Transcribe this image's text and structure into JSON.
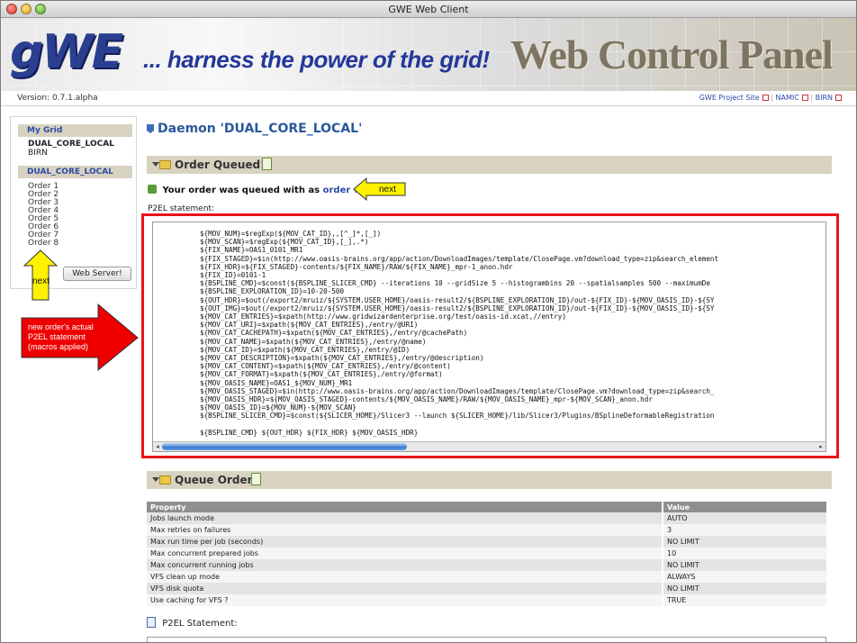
{
  "window": {
    "title": "GWE Web Client"
  },
  "banner": {
    "logo_text": "gWE",
    "tagline": "... harness the power of the grid!",
    "panel_title": "Web Control Panel"
  },
  "version_bar": {
    "version": "Version: 0.7.1.alpha",
    "links": [
      "GWE Project Site",
      "NAMIC",
      "BIRN"
    ],
    "separator": "|"
  },
  "sidebar": {
    "my_grid_header": "My Grid",
    "grid_items": [
      "DUAL_CORE_LOCAL",
      "BIRN"
    ],
    "daemon_header": "DUAL_CORE_LOCAL",
    "orders": [
      "Order 1",
      "Order 2",
      "Order 3",
      "Order 4",
      "Order 5",
      "Order 6",
      "Order 7",
      "Order 8"
    ],
    "web_server_button": "Web Server!"
  },
  "main": {
    "daemon_title": "Daemon 'DUAL_CORE_LOCAL'",
    "order_queued": {
      "section_label": "Order Queued!",
      "message_prefix": "Your order was queued with as",
      "order_link": "order # 8",
      "message_suffix": ".",
      "p2el_label": "P2EL statement:",
      "code_lines": [
        "${MOV_NUM}=$regExp(${MOV_CAT_ID},,[^_]*,[_])",
        "${MOV_SCAN}=$regExp(${MOV_CAT_ID},[_],.*)",
        "${FIX_NAME}=OAS1_0101_MR1",
        "${FIX_STAGED}=$in(http://www.oasis-brains.org/app/action/DownloadImages/template/ClosePage.vm?download_type=zip&search_element",
        "${FIX_HDR}=${FIX_STAGED}-contents/${FIX_NAME}/RAW/${FIX_NAME}_mpr-1_anon.hdr",
        "${FIX_ID}=0101-1",
        "${BSPLINE_CMD}=$const(${BSPLINE_SLICER_CMD} --iterations 10 --gridSize 5 --histogrambins 20 --spatialsamples 500 --maximumDe",
        "${BSPLINE_EXPLORATION_ID}=10-20-500",
        "${OUT_HDR}=$out(/export2/mruiz/${SYSTEM.USER_HOME}/oasis-result2/${BSPLINE_EXPLORATION_ID}/out-${FIX_ID}-${MOV_OASIS_ID}-${SY",
        "${OUT_IMG}=$out(/export2/mruiz/${SYSTEM.USER_HOME}/oasis-result2/${BSPLINE_EXPLORATION_ID}/out-${FIX_ID}-${MOV_OASIS_ID}-${SY",
        "${MOV_CAT_ENTRIES}=$xpath(http://www.gridwizardenterprise.org/test/oasis-id.xcat,//entry)",
        "${MOV_CAT_URI}=$xpath(${MOV_CAT_ENTRIES},/entry/@URI)",
        "${MOV_CAT_CACHEPATH}=$xpath(${MOV_CAT_ENTRIES},/entry/@cachePath)",
        "${MOV_CAT_NAME}=$xpath(${MOV_CAT_ENTRIES},/entry/@name)",
        "${MOV_CAT_ID}=$xpath(${MOV_CAT_ENTRIES},/entry/@ID)",
        "${MOV_CAT_DESCRIPTION}=$xpath(${MOV_CAT_ENTRIES},/entry/@description)",
        "${MOV_CAT_CONTENT}=$xpath(${MOV_CAT_ENTRIES},/entry/@content)",
        "${MOV_CAT_FORMAT}=$xpath(${MOV_CAT_ENTRIES},/entry/@format)",
        "${MOV_OASIS_NAME}=OAS1_${MOV_NUM}_MR1",
        "${MOV_OASIS_STAGED}=$in(http://www.oasis-brains.org/app/action/DownloadImages/template/ClosePage.vm?download_type=zip&search_",
        "${MOV_OASIS_HDR}=${MOV_OASIS_STAGED}-contents/${MOV_OASIS_NAME}/RAW/${MOV_OASIS_NAME}_mpr-${MOV_SCAN}_anon.hdr",
        "${MOV_OASIS_ID}=${MOV_NUM}-${MOV_SCAN}",
        "${BSPLINE_SLICER_CMD}=$const(${SLICER_HOME}/Slicer3 --launch ${SLICER_HOME}/lib/Slicer3/Plugins/BSplineDeformableRegistration",
        "",
        "${BSPLINE_CMD} ${OUT_HDR} ${FIX_HDR} ${MOV_OASIS_HDR}"
      ]
    },
    "queue_order": {
      "section_label": "Queue Order",
      "table_headers": [
        "Property",
        "Value"
      ],
      "rows": [
        [
          "Jobs launch mode",
          "AUTO"
        ],
        [
          "Max retries on failures",
          "3"
        ],
        [
          "Max run time per job (seconds)",
          "NO LIMIT"
        ],
        [
          "Max concurrent prepared jobs",
          "10"
        ],
        [
          "Max concurrent running jobs",
          "NO LIMIT"
        ],
        [
          "VFS clean up mode",
          "ALWAYS"
        ],
        [
          "VFS disk quota",
          "NO LIMIT"
        ],
        [
          "Use caching for VFS ?",
          "TRUE"
        ]
      ],
      "p2el_statement_label": "P2EL Statement:"
    }
  },
  "annotations": {
    "next_top": "next",
    "next_left": "next",
    "red_note": [
      "new order's actual",
      "P2EL statement",
      "(macros applied)"
    ]
  },
  "colors": {
    "accent_blue": "#2b4aa8",
    "section_bg": "#d8d3c0",
    "highlight_red": "#e8131a",
    "note_yellow": "#fff200"
  }
}
